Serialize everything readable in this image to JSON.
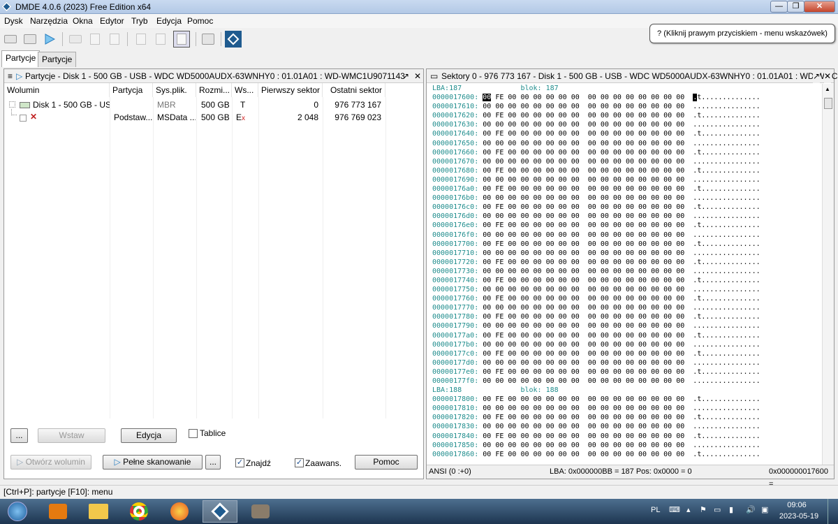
{
  "window": {
    "title": "DMDE 4.0.6 (2023) Free Edition x64",
    "min": "—",
    "max": "❐",
    "close": "✕"
  },
  "menu": [
    "Dysk",
    "Narzędzia",
    "Okna",
    "Edytor",
    "Tryb",
    "Edycja",
    "Pomoc"
  ],
  "tooltip": "? (Kliknij prawym przyciskiem - menu wskazówek)",
  "tabs": [
    "Partycje",
    "Partycje"
  ],
  "left_pane": {
    "title": "Partycje - Disk 1 - 500 GB - USB - WDC WD5000AUDX-63WNHY0 : 01.01A01 : WD-WMC1U9071143",
    "columns": [
      "Wolumin",
      "Partycja",
      "Sys.plik.",
      "Rozmi...",
      "Ws...",
      "Pierwszy sektor",
      "Ostatni sektor"
    ],
    "rows": [
      {
        "volume": "Disk 1 - 500 GB - US...",
        "partition": "",
        "fs": "MBR",
        "size": "500 GB",
        "flag": "T",
        "first": "0",
        "last": "976 773 167"
      },
      {
        "volume": "",
        "partition": "Podstaw...",
        "fs": "MSData ...",
        "size": "500 GB",
        "flag": "E",
        "flag_sub": "x",
        "first": "2 048",
        "last": "976 769 023"
      }
    ],
    "buttons": {
      "more1": "...",
      "insert": "Wstaw",
      "edit": "Edycja",
      "tables": "Tablice",
      "open_volume": "Otwórz wolumin",
      "full_scan": "Pełne skanowanie",
      "more2": "...",
      "find": "Znajdź",
      "advanced": "Zaawans.",
      "help": "Pomoc"
    },
    "checkbox_find": true,
    "checkbox_advanced": true,
    "checkbox_tables": false
  },
  "right_pane": {
    "title": "Sektory 0 - 976 773 167 - Disk 1 - 500 GB - USB - WDC WD5000AUDX-63WNHY0 : 01.01A01 : WD-WMC1U9...",
    "lba1": "LBA:187",
    "block1": "blok: 187",
    "lba2": "LBA:188",
    "block2": "blok: 188",
    "addresses1": [
      "0000017600:",
      "0000017610:",
      "0000017620:",
      "0000017630:",
      "0000017640:",
      "0000017650:",
      "0000017660:",
      "0000017670:",
      "0000017680:",
      "0000017690:",
      "00000176a0:",
      "00000176b0:",
      "00000176c0:",
      "00000176d0:",
      "00000176e0:",
      "00000176f0:",
      "0000017700:",
      "0000017710:",
      "0000017720:",
      "0000017730:",
      "0000017740:",
      "0000017750:",
      "0000017760:",
      "0000017770:",
      "0000017780:",
      "0000017790:",
      "00000177a0:",
      "00000177b0:",
      "00000177c0:",
      "00000177d0:",
      "00000177e0:",
      "00000177f0:"
    ],
    "addresses2": [
      "0000017800:",
      "0000017810:",
      "0000017820:",
      "0000017830:",
      "0000017840:",
      "0000017850:",
      "0000017860:"
    ],
    "row_fe": "00 FE 00 00 00 00 00 00  00 00 00 00 00 00 00 00",
    "row_zero": "00 00 00 00 00 00 00 00  00 00 00 00 00 00 00 00",
    "ascii_fe": ".t..............",
    "ascii_zero": "................",
    "status_left": "ANSI (0 :+0)",
    "status_mid": "LBA: 0x000000BB = 187  Pos: 0x0000 = 0",
    "status_right": "0x000000017600 ="
  },
  "statusbar": "[Ctrl+P]: partycje  [F10]: menu",
  "taskbar": {
    "lang": "PL",
    "time": "09:06",
    "date": "2023-05-19"
  }
}
